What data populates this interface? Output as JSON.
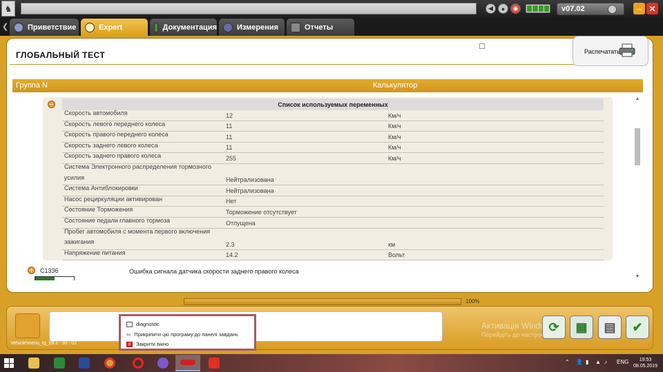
{
  "app": {
    "version": "v07.02",
    "logo_glyph": "♞"
  },
  "tabs": [
    {
      "label": "Приветствие",
      "active": false
    },
    {
      "label": "Expert",
      "active": true
    },
    {
      "label": "Документация",
      "active": false
    },
    {
      "label": "Измерения",
      "active": false
    },
    {
      "label": "Отчеты",
      "active": false
    }
  ],
  "page": {
    "title": "ГЛОБАЛЬНЫЙ ТЕСТ",
    "print_label": "Распечатать"
  },
  "group": {
    "name": "Группа N",
    "computer": "Калькулятор"
  },
  "variables": {
    "header": "Список используемых переменных",
    "rows": [
      {
        "name": "Скорость автомобиля",
        "value": "12",
        "unit": "Км/ч"
      },
      {
        "name": "Скорость левого переднего колеса",
        "value": "11",
        "unit": "Км/ч"
      },
      {
        "name": "Скорость правого переднего колеса",
        "value": "11",
        "unit": "Км/ч"
      },
      {
        "name": "Скорость заднего левого колеса",
        "value": "11",
        "unit": "Км/ч"
      },
      {
        "name": "Скорость заднего правого колеса",
        "value": "255",
        "unit": "Км/ч"
      },
      {
        "name": "Система Электронного распределения тормозного усилия",
        "value": "Нейтрализована",
        "unit": ""
      },
      {
        "name": "Система Антиблокировки",
        "value": "Нейтрализована",
        "unit": ""
      },
      {
        "name": "Насос рециркуляции активирован",
        "value": "Нет",
        "unit": ""
      },
      {
        "name": "Состояние Торможения",
        "value": "Торможение отсутствует",
        "unit": ""
      },
      {
        "name": "Состояние педали главного тормоза",
        "value": "Отпущена",
        "unit": ""
      },
      {
        "name": "Пробег автомобиля с момента первого включения зажигания",
        "value": "2.3",
        "unit": "км"
      },
      {
        "name": "Напряжение питания",
        "value": "14.2",
        "unit": "Вольт"
      }
    ]
  },
  "fault": {
    "code": "C1336",
    "description": "Ошибка сигнала датчика скорости заднего правого колеса"
  },
  "progress": {
    "percent": 100,
    "label": "100%"
  },
  "watermark": {
    "line1": "Активація Windows",
    "line2": "Перейдіть до настроек"
  },
  "status_path": "Vehicle\\menu_tg_b9.s : 30 : 02",
  "jumplist": {
    "app_name": "diagnostic",
    "pin": "Прикріпити цю програму до панелі завдань",
    "close": "Закрити вікно"
  },
  "taskbar": {
    "lang": "ENG",
    "time": "19:53",
    "date": "08.05.2019"
  },
  "colors": {
    "accent": "#d7a128",
    "active_tab": "#f0b83a"
  }
}
